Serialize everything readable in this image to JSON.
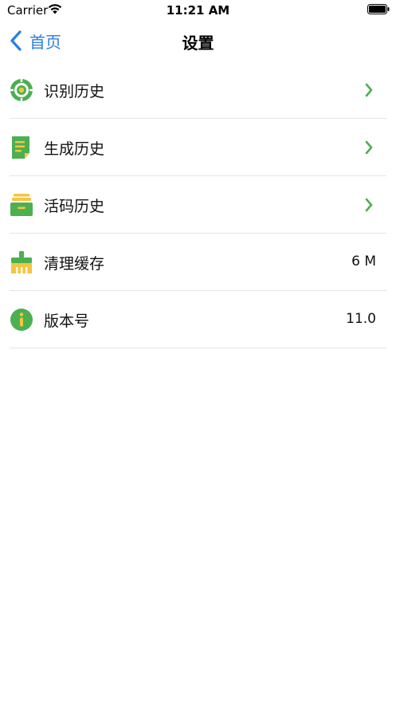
{
  "status_bar": {
    "carrier": "Carrier",
    "time": "11:21 AM"
  },
  "nav": {
    "back_label": "首页",
    "title": "设置"
  },
  "colors": {
    "accent_blue": "#2a7de1",
    "accent_green": "#4caf50",
    "accent_yellow": "#f5c542"
  },
  "settings": {
    "items": [
      {
        "label": "识别历史",
        "icon": "scan-target-icon",
        "value": ""
      },
      {
        "label": "生成历史",
        "icon": "document-icon",
        "value": ""
      },
      {
        "label": "活码历史",
        "icon": "archive-box-icon",
        "value": ""
      },
      {
        "label": "清理缓存",
        "icon": "broom-icon",
        "value": "6 M"
      },
      {
        "label": "版本号",
        "icon": "info-icon",
        "value": "11.0"
      }
    ]
  }
}
